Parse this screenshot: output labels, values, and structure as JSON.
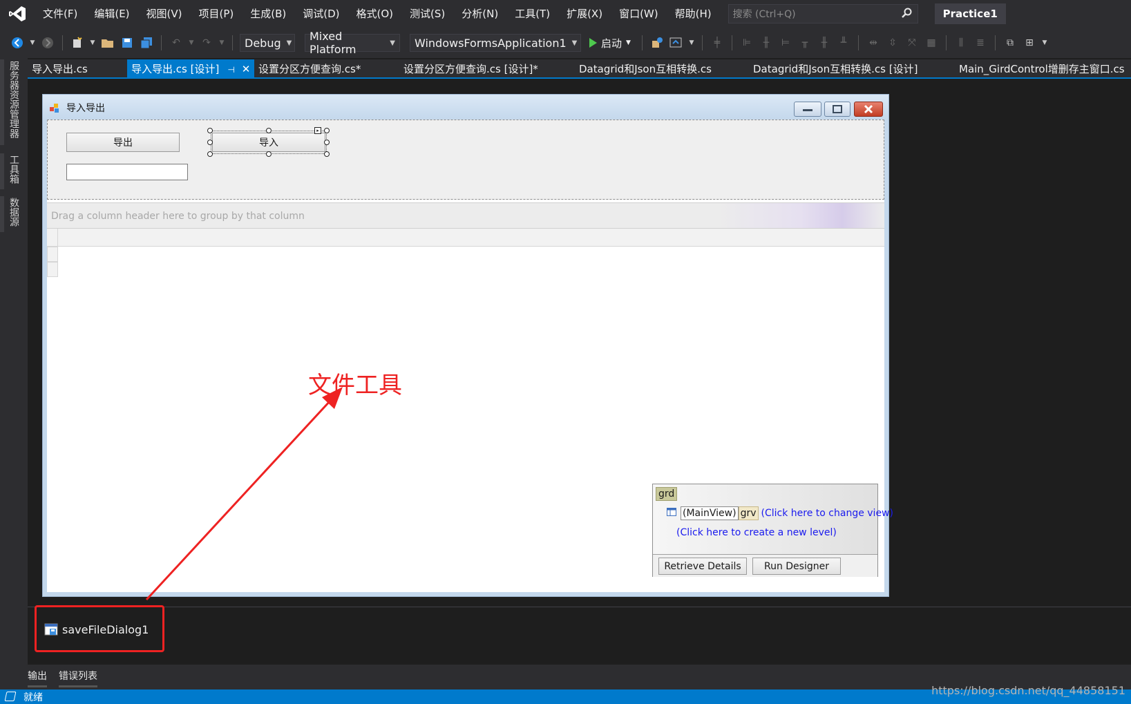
{
  "menubar": {
    "items": [
      "文件(F)",
      "编辑(E)",
      "视图(V)",
      "项目(P)",
      "生成(B)",
      "调试(D)",
      "格式(O)",
      "测试(S)",
      "分析(N)",
      "工具(T)",
      "扩展(X)",
      "窗口(W)",
      "帮助(H)"
    ],
    "search_placeholder": "搜索 (Ctrl+Q)",
    "project_name": "Practice1"
  },
  "toolbar": {
    "config": "Debug",
    "platform": "Mixed Platform",
    "startup_project": "WindowsFormsApplication1",
    "start_label": "启动"
  },
  "side_tabs": [
    "服务器资源管理器",
    "工具箱",
    "数据源"
  ],
  "doc_tabs": [
    "导入导出.cs",
    "导入导出.cs [设计]",
    "设置分区方便查询.cs*",
    "设置分区方便查询.cs [设计]*",
    "Datagrid和Json互相转换.cs",
    "Datagrid和Json互相转换.cs [设计]",
    "Main_GirdControl增删存主窗口.cs"
  ],
  "form": {
    "title": "导入导出",
    "export_button": "导出",
    "import_button": "导入",
    "group_panel_text": "Drag a column header here to group by that column"
  },
  "smart_panel": {
    "grid_tag": "grd",
    "main_view": "(MainView)",
    "view_tag": "grv",
    "change_view_link": "(Click here to change view)",
    "new_level_link": "(Click here to create a new level)",
    "retrieve_button": "Retrieve Details",
    "designer_button": "Run Designer"
  },
  "annotation": {
    "text": "文件工具",
    "color": "#ee2222"
  },
  "tray": {
    "component_name": "saveFileDialog1"
  },
  "bottom_tabs": [
    "输出",
    "错误列表"
  ],
  "status": {
    "text": "就绪"
  },
  "watermark": "https://blog.csdn.net/qq_44858151",
  "colors": {
    "accent": "#007acc",
    "chrome": "#2d2d30",
    "canvas": "#1e1e1e"
  }
}
